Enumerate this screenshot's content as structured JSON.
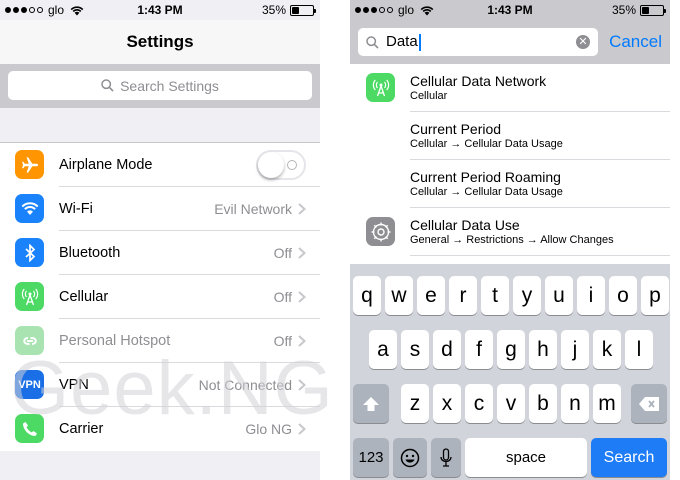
{
  "left": {
    "status": {
      "carrier": "glo",
      "time": "1:43 PM",
      "battery": "35%",
      "battery_level": 0.35
    },
    "nav_title": "Settings",
    "search_placeholder": "Search Settings",
    "rows": [
      {
        "label": "Airplane Mode",
        "value": "",
        "icon": "airplane-icon",
        "color": "#ff9500",
        "control": "toggle-off"
      },
      {
        "label": "Wi-Fi",
        "value": "Evil Network",
        "icon": "wifi-icon",
        "color": "#1a82fb"
      },
      {
        "label": "Bluetooth",
        "value": "Off",
        "icon": "bluetooth-icon",
        "color": "#1a82fb"
      },
      {
        "label": "Cellular",
        "value": "Off",
        "icon": "cellular-antenna-icon",
        "color": "#4cd964"
      },
      {
        "label": "Personal Hotspot",
        "value": "Off",
        "icon": "hotspot-icon",
        "color": "#a8e3b1",
        "dimmed": true
      },
      {
        "label": "VPN",
        "value": "Not Connected",
        "icon": "vpn-icon",
        "icon_text": "VPN",
        "color": "#1a6fe6"
      },
      {
        "label": "Carrier",
        "value": "Glo NG",
        "icon": "phone-icon",
        "color": "#4cd964"
      }
    ]
  },
  "right": {
    "status": {
      "carrier": "glo",
      "time": "1:43 PM",
      "battery": "35%",
      "battery_level": 0.35
    },
    "search_value": "Data",
    "cancel_label": "Cancel",
    "results": [
      {
        "title": "Cellular Data Network",
        "subtitle": "Cellular",
        "icon": "cellular-antenna-icon",
        "color": "#4cd964"
      },
      {
        "title": "Current Period",
        "subtitle": "Cellular → Cellular Data Usage"
      },
      {
        "title": "Current Period Roaming",
        "subtitle": "Cellular → Cellular Data Usage"
      },
      {
        "title": "Cellular Data Use",
        "subtitle": "General → Restrictions → Allow Changes",
        "icon": "gear-icon",
        "color": "#8e8e93"
      }
    ],
    "keyboard": {
      "row1": [
        "q",
        "w",
        "e",
        "r",
        "t",
        "y",
        "u",
        "i",
        "o",
        "p"
      ],
      "row2": [
        "a",
        "s",
        "d",
        "f",
        "g",
        "h",
        "j",
        "k",
        "l"
      ],
      "row3": [
        "z",
        "x",
        "c",
        "v",
        "b",
        "n",
        "m"
      ],
      "numbers_label": "123",
      "space_label": "space",
      "search_label": "Search"
    }
  },
  "watermark": "Geek.NG"
}
